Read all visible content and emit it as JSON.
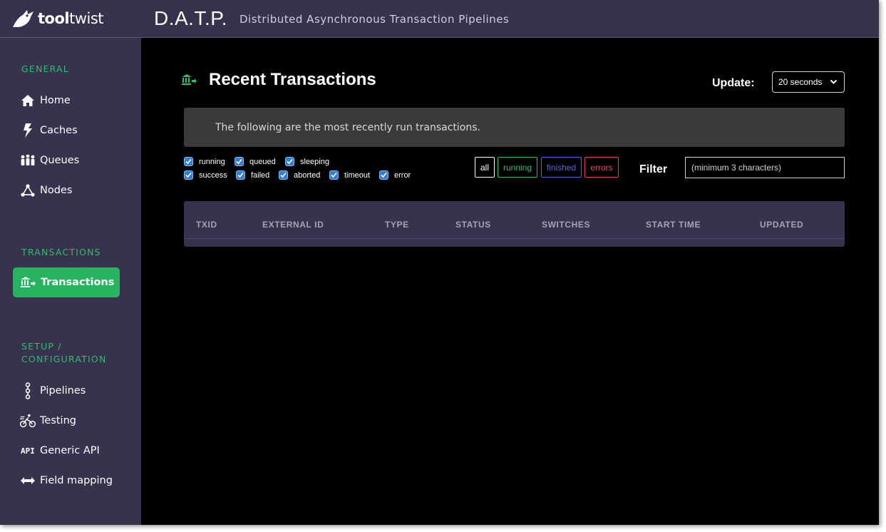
{
  "header": {
    "logo_bold": "tool",
    "logo_regular": "twist",
    "app_title": "D.A.T.P.",
    "app_subtitle": "Distributed Asynchronous Transaction Pipelines"
  },
  "sidebar": {
    "general_label": "GENERAL",
    "general_items": [
      {
        "label": "Home",
        "icon": "home-icon"
      },
      {
        "label": "Caches",
        "icon": "lightning-icon"
      },
      {
        "label": "Queues",
        "icon": "people-queue-icon"
      },
      {
        "label": "Nodes",
        "icon": "nodes-icon"
      }
    ],
    "transactions_label": "TRANSACTIONS",
    "transactions_item": {
      "label": "Transactions",
      "icon": "bank-transfer-icon"
    },
    "setup_label_line1": "SETUP /",
    "setup_label_line2": "CONFIGURATION",
    "setup_items": [
      {
        "label": "Pipelines",
        "icon": "pipeline-icon"
      },
      {
        "label": "Testing",
        "icon": "cyclist-icon"
      },
      {
        "label": "Generic API",
        "icon": "api-icon"
      },
      {
        "label": "Field mapping",
        "icon": "arrows-horizontal-icon"
      }
    ]
  },
  "main": {
    "title": "Recent Transactions",
    "update_label": "Update:",
    "update_value": "20 seconds",
    "info_text": "The following are the most recently run transactions.",
    "checkboxes_row1": [
      {
        "label": "running",
        "checked": true
      },
      {
        "label": "queued",
        "checked": true
      },
      {
        "label": "sleeping",
        "checked": true
      }
    ],
    "checkboxes_row2": [
      {
        "label": "success",
        "checked": true
      },
      {
        "label": "failed",
        "checked": true
      },
      {
        "label": "aborted",
        "checked": true
      },
      {
        "label": "timeout",
        "checked": true
      },
      {
        "label": "error",
        "checked": true
      }
    ],
    "filter_buttons": [
      {
        "label": "all",
        "color": "#ffffff"
      },
      {
        "label": "running",
        "color": "#2fbd6c"
      },
      {
        "label": "finished",
        "color": "#5a63d8"
      },
      {
        "label": "errors",
        "color": "#e0475c"
      }
    ],
    "filter_label": "Filter",
    "filter_placeholder": "(minimum 3 characters)",
    "table_headers": [
      "TXID",
      "EXTERNAL ID",
      "TYPE",
      "STATUS",
      "SWITCHES",
      "START TIME",
      "UPDATED"
    ]
  },
  "colors": {
    "header_bg": "#37324d",
    "accent_green": "#27b35f",
    "section_label": "#2fbd6c",
    "checkbox_blue": "#2f7fd6"
  }
}
